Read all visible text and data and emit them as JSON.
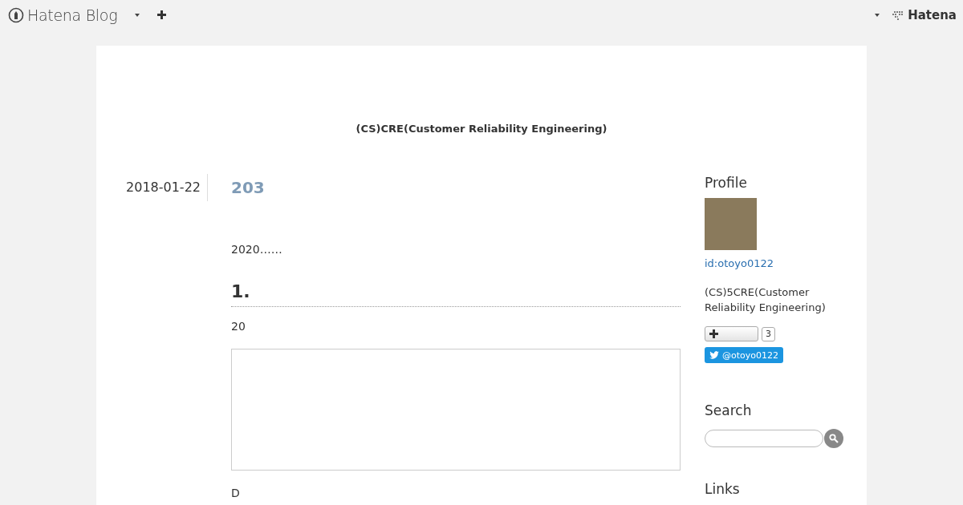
{
  "header": {
    "logo": "Hatena Blog",
    "brand": "Hatena"
  },
  "blog_title": "(CS)CRE(Customer Reliability Engineering)",
  "entry": {
    "date": "2018-01-22",
    "title": "203",
    "blocks": [
      {
        "kind": "paragraph",
        "text": "2020……"
      },
      {
        "kind": "heading",
        "text": "1."
      },
      {
        "kind": "paragraph",
        "text": "20"
      },
      {
        "kind": "embed"
      },
      {
        "kind": "paragraph",
        "text": "D"
      }
    ]
  },
  "sidebar": {
    "profile": {
      "heading": "Profile",
      "user_id": "id:otoyo0122",
      "description": "(CS)5CRE(Customer Reliability Engineering)",
      "subscriber_count": "3",
      "twitter": "@otoyo0122"
    },
    "search": {
      "heading": "Search"
    },
    "links": {
      "heading": "Links"
    }
  }
}
